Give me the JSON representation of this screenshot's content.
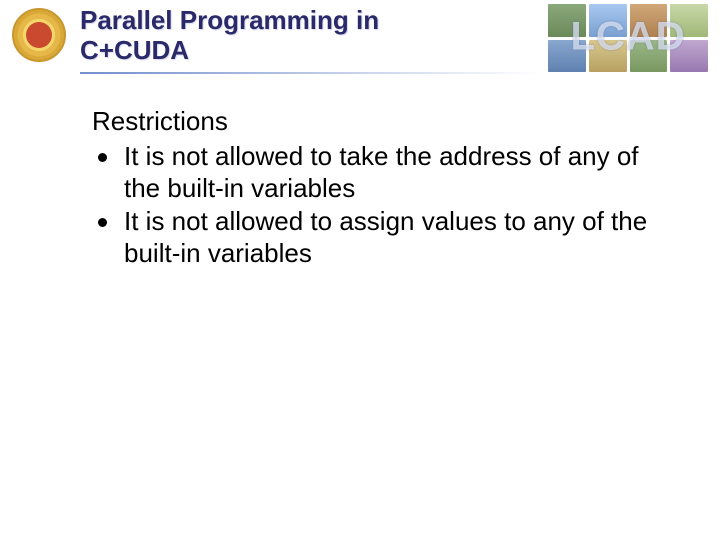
{
  "header": {
    "title_line1": "Parallel Programming in",
    "title_line2": "C+CUDA",
    "right_logo_text": "LCAD"
  },
  "content": {
    "section_heading": "Restrictions",
    "bullets": [
      "It is not allowed to take the address of any of the built-in variables",
      "It is not allowed to assign values to any of the built-in variables"
    ]
  }
}
